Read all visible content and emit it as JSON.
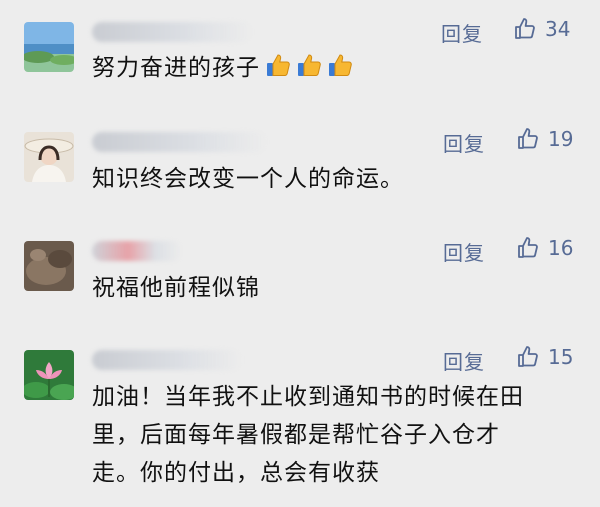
{
  "comments": [
    {
      "reply_label": "回复",
      "likes": "34",
      "text": "努力奋进的孩子",
      "emoji": [
        "thumbs-up",
        "thumbs-up",
        "thumbs-up"
      ],
      "avatar": "beach-avatar"
    },
    {
      "reply_label": "回复",
      "likes": "19",
      "text": "知识终会改变一个人的命运。",
      "avatar": "woman-hat-avatar"
    },
    {
      "reply_label": "回复",
      "likes": "16",
      "text": "祝福他前程似锦",
      "avatar": "rock-avatar"
    },
    {
      "reply_label": "回复",
      "likes": "15",
      "text_lines": [
        "加油！当年我不止收到通知书的时候在田",
        "里，后面每年暑假都是帮忙谷子入仓才",
        "走。你的付出，总会有收获"
      ],
      "avatar": "lotus-avatar"
    }
  ],
  "colors": {
    "background": "#ededed",
    "link": "#576b95",
    "text": "#111111"
  }
}
